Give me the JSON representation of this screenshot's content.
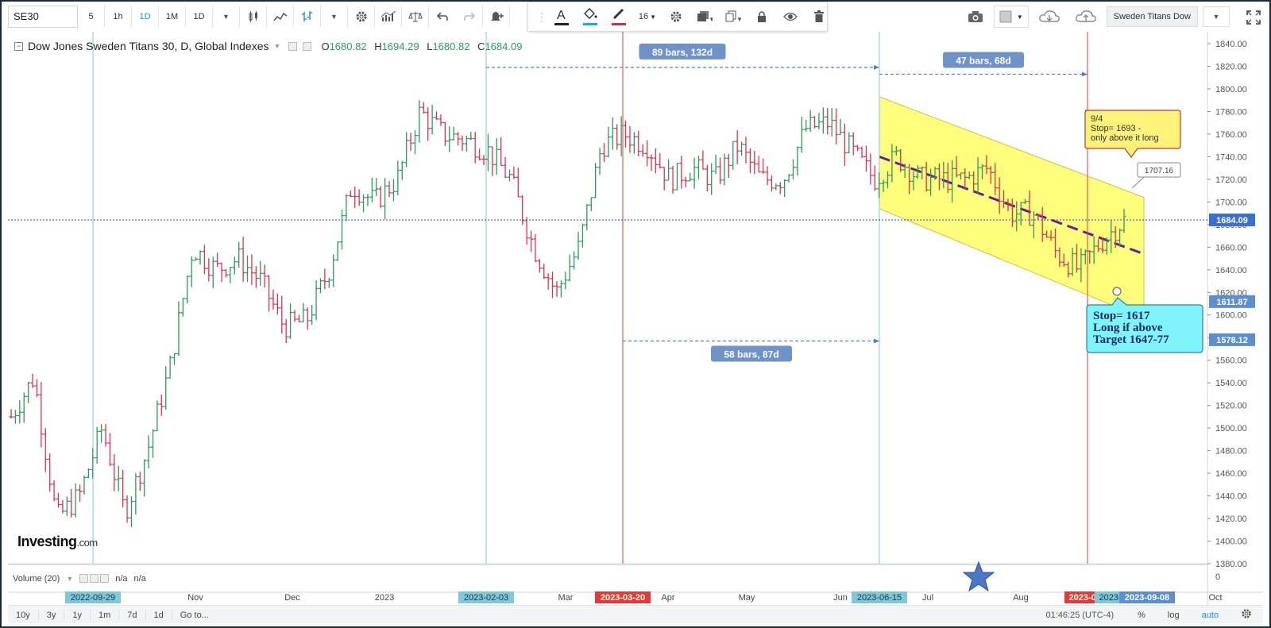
{
  "toolbar": {
    "symbol": "SE30",
    "intervals": [
      "5",
      "1h",
      "1D",
      "1M",
      "1D"
    ],
    "active_interval_index": 2,
    "icons": [
      "candles-icon",
      "line-icon",
      "bars-icon",
      "settings-icon",
      "indicators-icon",
      "compare-icon",
      "undo-icon",
      "redo-icon",
      "alert-icon"
    ]
  },
  "draw_toolbar": {
    "font_size": "16",
    "icons": [
      "text-color-icon",
      "fill-color-icon",
      "line-color-icon",
      "gear-icon",
      "layers-icon",
      "clone-icon",
      "lock-icon",
      "eye-icon",
      "trash-icon"
    ],
    "text_color": "#222222",
    "fill_color": "#00bcd4",
    "line_color": "#d32f2f"
  },
  "right_tools": {
    "layout_name": "Sweden Titans Dow"
  },
  "legend": {
    "title": "Dow Jones Sweden Titans 30, D, Global Indexes",
    "o_label": "O",
    "o": "1680.82",
    "h_label": "H",
    "h": "1694.29",
    "l_label": "L",
    "l": "1680.82",
    "c_label": "C",
    "c": "1684.09"
  },
  "price_axis": {
    "ticks": [
      "1840.00",
      "1820.00",
      "1800.00",
      "1780.00",
      "1760.00",
      "1740.00",
      "1720.00",
      "1700.00",
      "1680.00",
      "1660.00",
      "1640.00",
      "1620.00",
      "1600.00",
      "1580.00",
      "1560.00",
      "1540.00",
      "1520.00",
      "1500.00",
      "1480.00",
      "1460.00",
      "1440.00",
      "1420.00",
      "1400.00",
      "1380.00"
    ],
    "last_price": "1684.09",
    "marker_1": "1611.87",
    "marker_2": "1578.12",
    "volume_zero": "0"
  },
  "time_axis": {
    "labels": [
      "Nov",
      "Dec",
      "2023",
      "Mar",
      "Apr",
      "May",
      "Jun",
      "Jul",
      "Aug",
      "Oct"
    ],
    "highlights": [
      {
        "text": "2022-09-29",
        "color": "#7ec8d8"
      },
      {
        "text": "2023-02-03",
        "color": "#7ec8d8"
      },
      {
        "text": "2023-03-20",
        "color": "#e53935"
      },
      {
        "text": "2023-06-15",
        "color": "#7ec8d8"
      },
      {
        "text": "2023-08",
        "color": "#e53935"
      },
      {
        "text": "2023-0",
        "color": "#7ec8d8"
      },
      {
        "text": "2023-09-08",
        "color": "#5b8fd0"
      }
    ]
  },
  "annotations": {
    "range_1": "89 bars, 132d",
    "range_2": "47 bars, 68d",
    "range_3": "58 bars, 87d",
    "callout_yellow": [
      "9/4",
      "Stop= 1693 -",
      "only above it long"
    ],
    "callout_price": "1707.16",
    "callout_cyan": [
      "Stop= 1617",
      "Long if above",
      "Target 1647-77"
    ]
  },
  "volume": {
    "label": "Volume (20)",
    "v1": "n/a",
    "v2": "n/a"
  },
  "bottom_bar": {
    "ranges": [
      "10y",
      "3y",
      "1y",
      "1m",
      "7d",
      "1d",
      "Go to..."
    ],
    "time": "01:46:25 (UTC-4)",
    "pct": "%",
    "log": "log",
    "auto": "auto"
  },
  "logo": {
    "name": "Investing",
    "suffix": ".com"
  },
  "colors": {
    "up": "#2a9c5a",
    "down": "#e5304a",
    "channel_fill": "#ffff66",
    "cyan_line": "#7ec8d8",
    "red_line": "#e53935",
    "midline": "#6a1b9a",
    "price_line": "#2a3fd0",
    "label_blue": "#6f93c9"
  },
  "chart_data": {
    "type": "bar",
    "title": "Dow Jones Sweden Titans 30, D, Global Indexes",
    "x_range": [
      "2022-09-29",
      "2023-09-08"
    ],
    "ylim": [
      1380,
      1840
    ],
    "series": [
      {
        "x": [
          "2022-09-29",
          "2022-10-07",
          "2022-10-13",
          "2022-10-21",
          "2022-10-28",
          "2022-11-04",
          "2022-11-11",
          "2022-11-18",
          "2022-11-25",
          "2022-12-02",
          "2022-12-09",
          "2022-12-16",
          "2022-12-23",
          "2022-12-30",
          "2023-01-06",
          "2023-01-13",
          "2023-01-20",
          "2023-01-27",
          "2023-02-03",
          "2023-02-10",
          "2023-02-17",
          "2023-02-24",
          "2023-03-03",
          "2023-03-10",
          "2023-03-20",
          "2023-03-24",
          "2023-03-31",
          "2023-04-06",
          "2023-04-14",
          "2023-04-21",
          "2023-04-28",
          "2023-05-05",
          "2023-05-12",
          "2023-05-19",
          "2023-05-26",
          "2023-06-02",
          "2023-06-09",
          "2023-06-15",
          "2023-06-23",
          "2023-06-30",
          "2023-07-07",
          "2023-07-14",
          "2023-07-21",
          "2023-07-28",
          "2023-08-04",
          "2023-08-11",
          "2023-08-18",
          "2023-08-25",
          "2023-09-01",
          "2023-09-08"
        ],
        "values": [
          1510,
          1545,
          1420,
          1440,
          1500,
          1425,
          1480,
          1555,
          1660,
          1640,
          1650,
          1630,
          1590,
          1595,
          1640,
          1715,
          1700,
          1720,
          1780,
          1760,
          1755,
          1745,
          1720,
          1660,
          1620,
          1660,
          1750,
          1760,
          1750,
          1720,
          1730,
          1720,
          1750,
          1720,
          1720,
          1765,
          1770,
          1745,
          1720,
          1740,
          1720,
          1720,
          1720,
          1730,
          1690,
          1690,
          1655,
          1640,
          1665,
          1684
        ]
      }
    ]
  }
}
